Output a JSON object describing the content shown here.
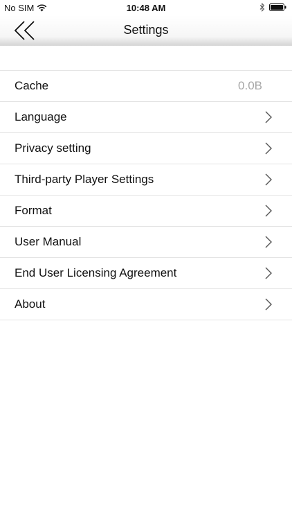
{
  "status_bar": {
    "carrier": "No SIM",
    "time": "10:48 AM"
  },
  "nav": {
    "title": "Settings",
    "back_icon": "double-chevron-left-icon"
  },
  "settings": [
    {
      "label": "Cache",
      "value": "0.0B",
      "has_chevron": false
    },
    {
      "label": "Language",
      "value": "",
      "has_chevron": true
    },
    {
      "label": "Privacy setting",
      "value": "",
      "has_chevron": true
    },
    {
      "label": "Third-party Player Settings",
      "value": "",
      "has_chevron": true
    },
    {
      "label": "Format",
      "value": "",
      "has_chevron": true
    },
    {
      "label": "User Manual",
      "value": "",
      "has_chevron": true
    },
    {
      "label": "End User Licensing Agreement",
      "value": "",
      "has_chevron": true
    },
    {
      "label": "About",
      "value": "",
      "has_chevron": true
    }
  ],
  "colors": {
    "text": "#111111",
    "value_text": "#a6a6a6",
    "divider": "#e3e3e3",
    "chevron": "#555555"
  }
}
